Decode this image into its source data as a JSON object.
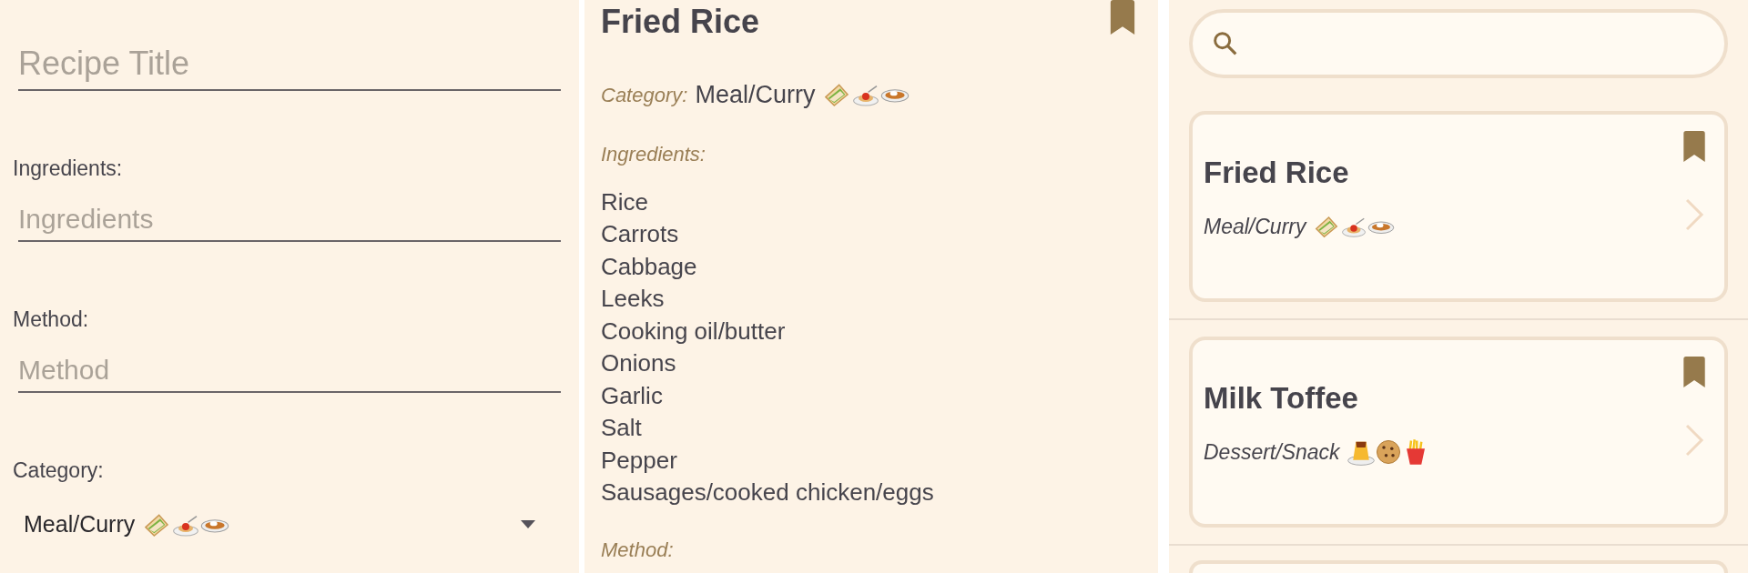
{
  "editor": {
    "title_field": {
      "placeholder": "Recipe Title"
    },
    "fields": [
      {
        "label": "Ingredients:",
        "placeholder": "Ingredients"
      },
      {
        "label": "Method:",
        "placeholder": "Method"
      }
    ],
    "category": {
      "label": "Category:",
      "value": "Meal/Curry",
      "emoji": [
        {
          "kind": "sandwich"
        },
        {
          "kind": "spaghetti"
        },
        {
          "kind": "curry"
        }
      ]
    }
  },
  "detail": {
    "title": "Fried Rice",
    "bookmarked": true,
    "category_label": "Category:",
    "category": "Meal/Curry",
    "emoji": [
      {
        "kind": "sandwich"
      },
      {
        "kind": "spaghetti"
      },
      {
        "kind": "curry"
      }
    ],
    "ingredients_label": "Ingredients:",
    "ingredients": [
      "Rice",
      "Carrots",
      "Cabbage",
      "Leeks",
      "Cooking oil/butter",
      "Onions",
      "Garlic",
      "Salt",
      "Pepper",
      "Sausages/cooked chicken/eggs"
    ],
    "method_label": "Method:"
  },
  "list": {
    "recipes": [
      {
        "title": "Fried Rice",
        "bookmarked": true,
        "category": "Meal/Curry",
        "emoji": [
          {
            "kind": "sandwich"
          },
          {
            "kind": "spaghetti"
          },
          {
            "kind": "curry"
          }
        ]
      },
      {
        "title": "Milk Toffee",
        "bookmarked": true,
        "category": "Dessert/Snack",
        "emoji": [
          {
            "kind": "flan"
          },
          {
            "kind": "cookie"
          },
          {
            "kind": "fries"
          }
        ]
      }
    ]
  }
}
